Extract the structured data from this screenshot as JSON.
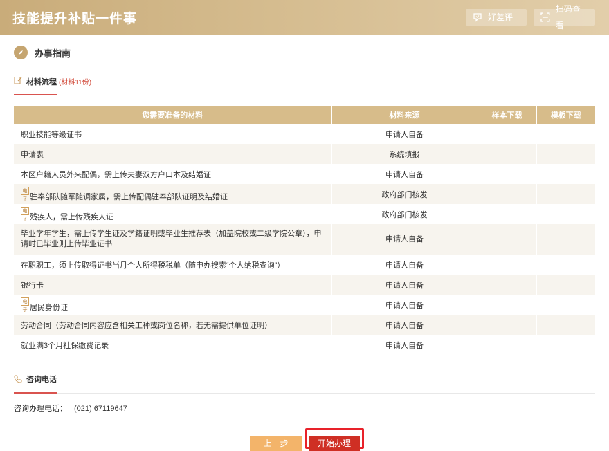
{
  "header": {
    "title": "技能提升补贴一件事",
    "review_label": "好差评",
    "scan_label": "扫码查看"
  },
  "guide": {
    "title": "办事指南"
  },
  "materials_tab": {
    "label": "材料流程",
    "count": "(材料11份)"
  },
  "table": {
    "headers": [
      "您需要准备的材料",
      "材料来源",
      "样本下载",
      "模板下载"
    ],
    "rows": [
      {
        "name": "职业技能等级证书",
        "source": "申请人自备",
        "badge": false
      },
      {
        "name": "申请表",
        "source": "系统填报",
        "badge": false
      },
      {
        "name": "本区户籍人员外来配偶，需上传夫妻双方户口本及结婚证",
        "source": "申请人自备",
        "badge": false
      },
      {
        "name": "驻奉部队随军随调家属，需上传配偶驻奉部队证明及结婚证",
        "source": "政府部门核发",
        "badge": true
      },
      {
        "name": "残疾人，需上传残疾人证",
        "source": "政府部门核发",
        "badge": true
      },
      {
        "name": "毕业学年学生，需上传学生证及学籍证明或毕业生推荐表（加盖院校或二级学院公章），申请时已毕业则上传毕业证书",
        "source": "申请人自备",
        "badge": false
      },
      {
        "name": "在职职工，须上传取得证书当月个人所得税税单（随申办搜索“个人纳税查询”）",
        "source": "申请人自备",
        "badge": false
      },
      {
        "name": "银行卡",
        "source": "申请人自备",
        "badge": false
      },
      {
        "name": "居民身份证",
        "source": "申请人自备",
        "badge": true
      },
      {
        "name": "劳动合同（劳动合同内容应含相关工种或岗位名称，若无需提供单位证明）",
        "source": "申请人自备",
        "badge": false
      },
      {
        "name": "就业满3个月社保缴费记录",
        "source": "申请人自备",
        "badge": false
      }
    ],
    "badge_text": "电子"
  },
  "contact": {
    "title": "咨询电话",
    "label": "咨询办理电话：",
    "phone": "(021) 67119647"
  },
  "actions": {
    "prev": "上一步",
    "start": "开始办理"
  }
}
